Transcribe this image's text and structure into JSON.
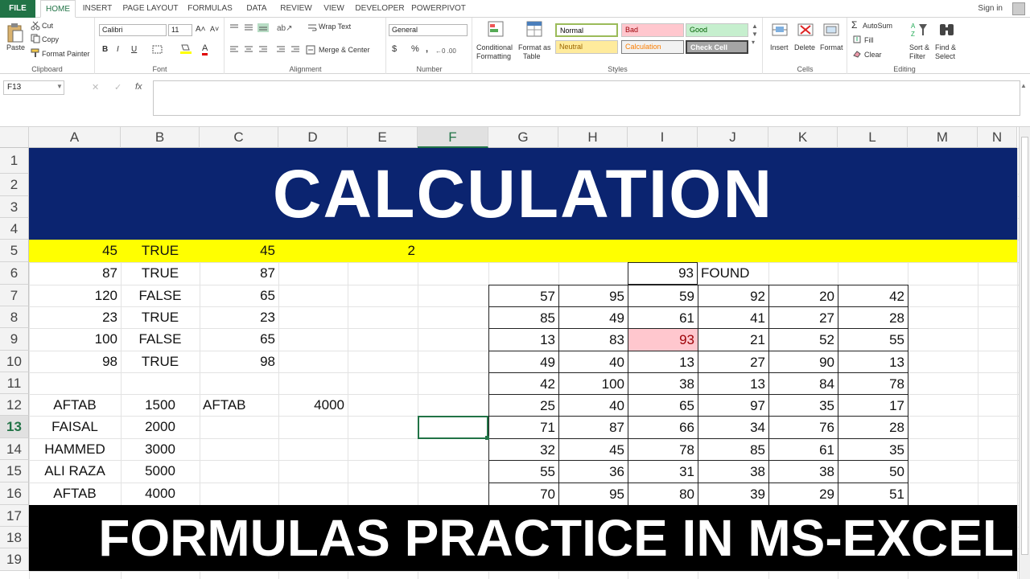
{
  "ribbon_tabs": [
    "FILE",
    "HOME",
    "INSERT",
    "PAGE LAYOUT",
    "FORMULAS",
    "DATA",
    "REVIEW",
    "VIEW",
    "DEVELOPER",
    "POWERPIVOT"
  ],
  "signin": "Sign in",
  "clipboard": {
    "paste": "Paste",
    "cut": "Cut",
    "copy": "Copy",
    "format_painter": "Format Painter",
    "label": "Clipboard"
  },
  "font": {
    "name": "Calibri",
    "size": "11",
    "bold": "B",
    "italic": "I",
    "underline": "U",
    "label": "Font"
  },
  "alignment": {
    "wrap": "Wrap Text",
    "merge": "Merge & Center",
    "label": "Alignment"
  },
  "number": {
    "format": "General",
    "currency": "$",
    "percent": "%",
    "comma": ",",
    "label": "Number"
  },
  "styles": {
    "conditional": "Conditional",
    "formatting": "Formatting",
    "format_as": "Format as",
    "table": "Table",
    "normal": "Normal",
    "bad": "Bad",
    "good": "Good",
    "neutral": "Neutral",
    "calculation": "Calculation",
    "check_cell": "Check Cell",
    "label": "Styles"
  },
  "cells": {
    "insert": "Insert",
    "delete": "Delete",
    "format": "Format",
    "label": "Cells"
  },
  "editing": {
    "autosum": "AutoSum",
    "fill": "Fill",
    "clear": "Clear",
    "sort": "Sort &",
    "filter": "Filter",
    "find": "Find &",
    "select": "Select",
    "label": "Editing"
  },
  "formula_bar": {
    "name_box": "F13",
    "fx": "fx",
    "formula": ""
  },
  "columns": [
    "A",
    "B",
    "C",
    "D",
    "E",
    "F",
    "G",
    "H",
    "I",
    "J",
    "K",
    "L",
    "M",
    "N"
  ],
  "rows": [
    "1",
    "2",
    "3",
    "4",
    "5",
    "6",
    "7",
    "8",
    "9",
    "10",
    "11",
    "12",
    "13",
    "14",
    "15",
    "16",
    "17",
    "18",
    "19"
  ],
  "banner_title": "CALCULATION",
  "banner_bottom": "FORMULAS PRACTICE IN MS-EXCEL",
  "colors": {
    "banner_blue": "#0b2470",
    "highlight_yellow": "#ffff00",
    "bad_pink": "#ffc7ce",
    "excel_green": "#217346"
  },
  "row5": {
    "a": "45",
    "b": "TRUE",
    "c": "45",
    "e": "2"
  },
  "left_table": [
    {
      "a": "87",
      "b": "TRUE",
      "c": "87"
    },
    {
      "a": "120",
      "b": "FALSE",
      "c": "65"
    },
    {
      "a": "23",
      "b": "TRUE",
      "c": "23"
    },
    {
      "a": "100",
      "b": "FALSE",
      "c": "65"
    },
    {
      "a": "98",
      "b": "TRUE",
      "c": "98"
    }
  ],
  "names": [
    {
      "a": "AFTAB",
      "b": "1500",
      "c": "AFTAB",
      "d": "4000"
    },
    {
      "a": "FAISAL",
      "b": "2000",
      "c": "",
      "d": ""
    },
    {
      "a": "HAMMED",
      "b": "3000",
      "c": "",
      "d": ""
    },
    {
      "a": "ALI RAZA",
      "b": "5000",
      "c": "",
      "d": ""
    },
    {
      "a": "AFTAB",
      "b": "4000",
      "c": "",
      "d": ""
    }
  ],
  "lookup": {
    "value": "93",
    "result": "FOUND"
  },
  "matrix": [
    [
      "57",
      "95",
      "59",
      "92",
      "20",
      "42"
    ],
    [
      "85",
      "49",
      "61",
      "41",
      "27",
      "28"
    ],
    [
      "13",
      "83",
      "93",
      "21",
      "52",
      "55"
    ],
    [
      "49",
      "40",
      "13",
      "27",
      "90",
      "13"
    ],
    [
      "42",
      "100",
      "38",
      "13",
      "84",
      "78"
    ],
    [
      "25",
      "40",
      "65",
      "97",
      "35",
      "17"
    ],
    [
      "71",
      "87",
      "66",
      "34",
      "76",
      "28"
    ],
    [
      "32",
      "45",
      "78",
      "85",
      "61",
      "35"
    ],
    [
      "55",
      "36",
      "31",
      "38",
      "38",
      "50"
    ],
    [
      "70",
      "95",
      "80",
      "39",
      "29",
      "51"
    ]
  ]
}
